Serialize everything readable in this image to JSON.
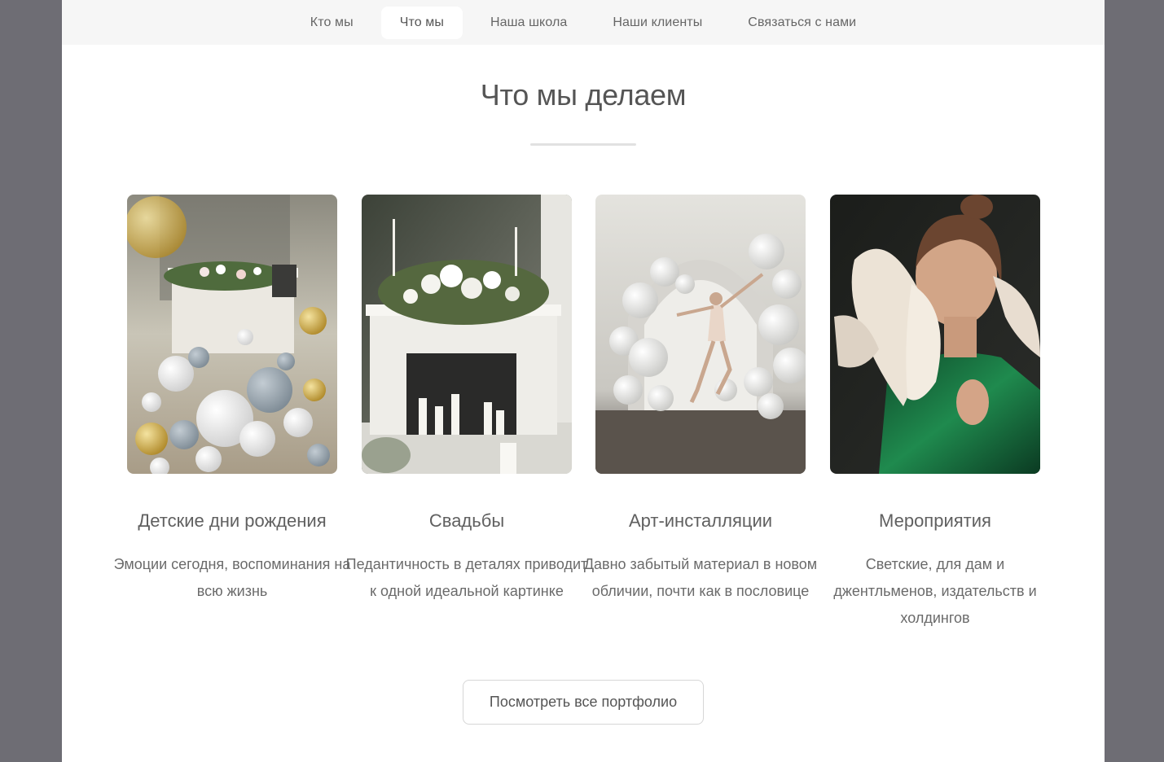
{
  "nav": {
    "items": [
      {
        "label": "Кто мы"
      },
      {
        "label": "Что мы",
        "active": true
      },
      {
        "label": "Наша школа"
      },
      {
        "label": "Наши клиенты"
      },
      {
        "label": "Связаться с нами"
      }
    ]
  },
  "section": {
    "title": "Что мы делаем"
  },
  "cards": [
    {
      "title": "Детские дни рождения",
      "description": "Эмоции сегодня, воспоминания на всю жизнь",
      "image_icon": "balloons-fireplace-photo"
    },
    {
      "title": "Свадьбы",
      "description": "Педантичность в деталях приводит к одной идеальной картинке",
      "image_icon": "wedding-fireplace-photo"
    },
    {
      "title": "Арт-инсталляции",
      "description": "Давно забытый материал в новом обличии, почти как в пословице",
      "image_icon": "ballerina-balloons-photo"
    },
    {
      "title": "Мероприятия",
      "description": "Светские, для дам и джентльменов, издательств и холдингов",
      "image_icon": "woman-feathers-photo"
    }
  ],
  "portfolio_button": {
    "label": "Посмотреть все портфолио"
  },
  "colors": {
    "backdrop": "#6e6d74",
    "nav_bg": "#f6f6f6",
    "page_bg": "#ffffff",
    "text": "#555555"
  }
}
